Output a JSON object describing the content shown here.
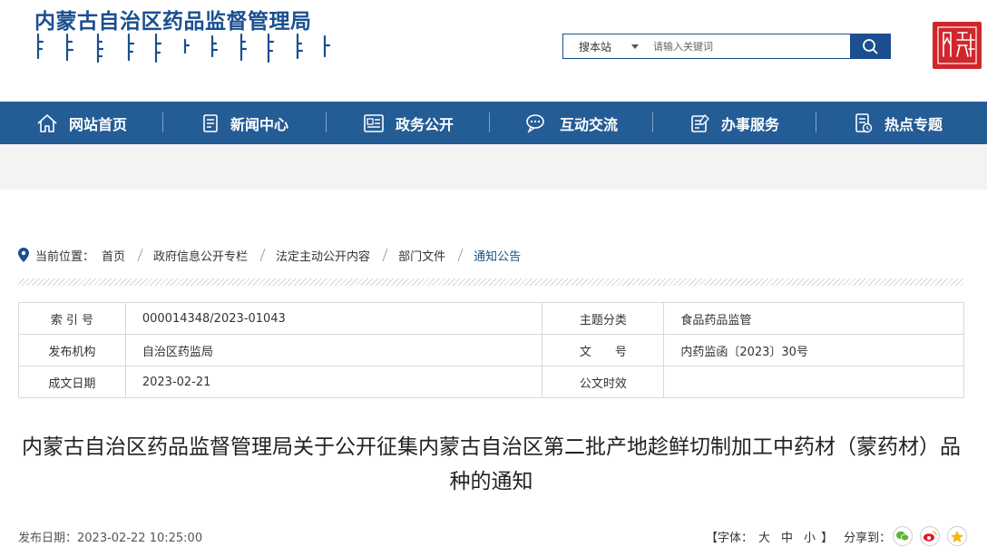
{
  "header": {
    "title": "内蒙古自治区药品监督管理局",
    "search": {
      "scope": "搜本站",
      "placeholder": "请输入关键词"
    },
    "seal_text": "内蒙古"
  },
  "nav": {
    "items": [
      {
        "label": "网站首页",
        "icon": "home-icon"
      },
      {
        "label": "新闻中心",
        "icon": "news-icon"
      },
      {
        "label": "政务公开",
        "icon": "document-icon"
      },
      {
        "label": "互动交流",
        "icon": "chat-icon"
      },
      {
        "label": "办事服务",
        "icon": "service-icon"
      },
      {
        "label": "热点专题",
        "icon": "topic-icon"
      }
    ]
  },
  "breadcrumb": {
    "prefix": "当前位置：",
    "items": [
      "首页",
      "政府信息公开专栏",
      "法定主动公开内容",
      "部门文件",
      "通知公告"
    ]
  },
  "info": {
    "index_label": "索 引 号",
    "index_value": "000014348/2023-01043",
    "topic_label": "主题分类",
    "topic_value": "食品药品监管",
    "org_label": "发布机构",
    "org_value": "自治区药监局",
    "docno_label": "文　　号",
    "docno_value": "内药监函〔2023〕30号",
    "date_label": "成文日期",
    "date_value": "2023-02-21",
    "validity_label": "公文时效",
    "validity_value": ""
  },
  "article": {
    "title": "内蒙古自治区药品监督管理局关于公开征集内蒙古自治区第二批产地趁鲜切制加工中药材（蒙药材）品种的通知",
    "publish_label": "发布日期：",
    "publish_value": "2023-02-22 10:25:00"
  },
  "tools": {
    "font_open": "【字体：",
    "font_large": "大",
    "font_medium": "中",
    "font_small": "小",
    "font_close": "】",
    "share_label": "分享到："
  },
  "colors": {
    "brand": "#1b4f8f",
    "nav": "#245c96",
    "seal": "#d0262c"
  }
}
